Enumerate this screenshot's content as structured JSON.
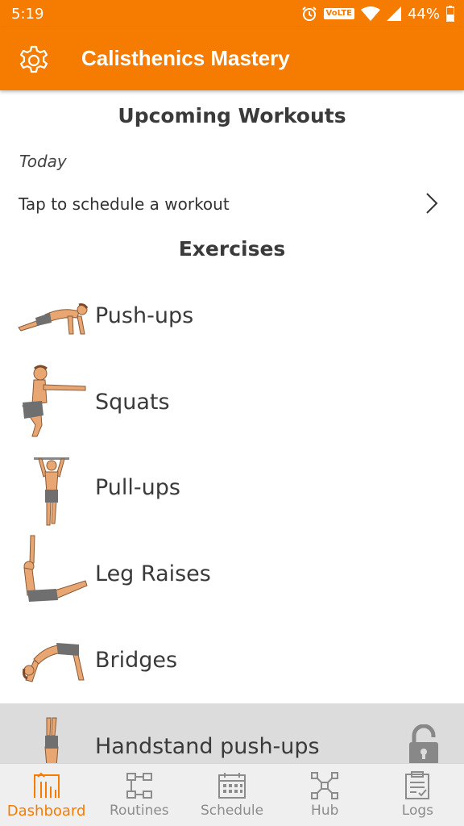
{
  "status_bar": {
    "time": "5:19",
    "network_badge": "VoLTE",
    "battery": "44%",
    "icons": [
      "alarm-icon",
      "wifi-icon",
      "signal-icon",
      "battery-icon"
    ]
  },
  "app_bar": {
    "title": "Calisthenics Mastery",
    "settings_icon": "gear-icon"
  },
  "upcoming": {
    "title": "Upcoming Workouts",
    "day_label": "Today",
    "schedule_prompt": "Tap to schedule a workout"
  },
  "exercises": {
    "title": "Exercises",
    "items": [
      {
        "label": "Push-ups",
        "locked": false
      },
      {
        "label": "Squats",
        "locked": false
      },
      {
        "label": "Pull-ups",
        "locked": false
      },
      {
        "label": "Leg Raises",
        "locked": false
      },
      {
        "label": "Bridges",
        "locked": false
      },
      {
        "label": "Handstand push-ups",
        "locked": true
      }
    ]
  },
  "bottom_nav": {
    "items": [
      {
        "label": "Dashboard",
        "icon": "dashboard-icon",
        "active": true
      },
      {
        "label": "Routines",
        "icon": "routines-icon",
        "active": false
      },
      {
        "label": "Schedule",
        "icon": "calendar-icon",
        "active": false
      },
      {
        "label": "Hub",
        "icon": "hub-icon",
        "active": false
      },
      {
        "label": "Logs",
        "icon": "logs-icon",
        "active": false
      }
    ]
  },
  "colors": {
    "accent": "#f57c00",
    "skin": "#e8a673",
    "shorts": "#6f6f6f",
    "inactive_nav": "#8c8c8c",
    "locked_row": "#dcdcdc"
  }
}
